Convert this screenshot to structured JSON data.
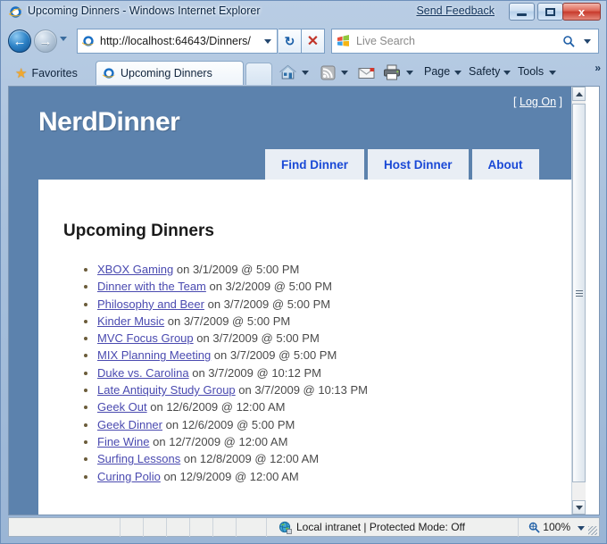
{
  "window": {
    "title": "Upcoming Dinners - Windows Internet Explorer",
    "send_feedback": "Send Feedback",
    "minimize_label": "Minimize",
    "maximize_label": "Maximize",
    "close_label": "x",
    "app_icon": "internet-explorer-icon"
  },
  "nav": {
    "back_glyph": "←",
    "forward_glyph": "→",
    "address_value": "http://localhost:64643/Dinners/",
    "refresh_glyph": "↻",
    "stop_glyph": "✕",
    "search_placeholder": "Live Search",
    "search_glyph": "⌕"
  },
  "commandbar": {
    "favorites_label": "Favorites",
    "favorites_icon": "star-icon",
    "tab_label": "Upcoming Dinners",
    "tab_icon": "internet-explorer-icon",
    "new_tab_label": "",
    "home_icon": "home-icon",
    "feeds_icon": "rss-feed-icon",
    "mail_icon": "mail-icon",
    "print_icon": "printer-icon",
    "menus": [
      "Page",
      "Safety",
      "Tools"
    ],
    "overflow_glyph": "»"
  },
  "page": {
    "brand": "NerdDinner",
    "logon_open": "[",
    "logon_label": "Log On",
    "logon_close": "]",
    "nav_tabs": [
      "Find Dinner",
      "Host Dinner",
      "About"
    ],
    "heading": "Upcoming Dinners",
    "dinners": [
      {
        "name": "XBOX Gaming",
        "when": " on 3/1/2009 @ 5:00 PM"
      },
      {
        "name": "Dinner with the Team",
        "when": " on 3/2/2009 @ 5:00 PM"
      },
      {
        "name": "Philosophy and Beer",
        "when": " on 3/7/2009 @ 5:00 PM"
      },
      {
        "name": "Kinder Music",
        "when": " on 3/7/2009 @ 5:00 PM"
      },
      {
        "name": "MVC Focus Group",
        "when": " on 3/7/2009 @ 5:00 PM"
      },
      {
        "name": "MIX Planning Meeting",
        "when": " on 3/7/2009 @ 5:00 PM"
      },
      {
        "name": "Duke vs. Carolina",
        "when": " on 3/7/2009 @ 10:12 PM"
      },
      {
        "name": "Late Antiquity Study Group",
        "when": " on 3/7/2009 @ 10:13 PM"
      },
      {
        "name": "Geek Out",
        "when": " on 12/6/2009 @ 12:00 AM"
      },
      {
        "name": "Geek Dinner",
        "when": " on 12/6/2009 @ 5:00 PM"
      },
      {
        "name": "Fine Wine",
        "when": " on 12/7/2009 @ 12:00 AM"
      },
      {
        "name": "Surfing Lessons",
        "when": " on 12/8/2009 @ 12:00 AM"
      },
      {
        "name": "Curing Polio",
        "when": " on 12/9/2009 @ 12:00 AM"
      }
    ]
  },
  "statusbar": {
    "zone_icon": "globe-icon",
    "zone_text": "Local intranet | Protected Mode: Off",
    "zoom_icon": "zoom-magnifier-icon",
    "zoom_level": "100%"
  },
  "colors": {
    "page_blue": "#5c82ad",
    "nav_tab_text": "#1a49d6",
    "link_purple": "#4a4ab0",
    "close_red": "#c83b2d"
  }
}
